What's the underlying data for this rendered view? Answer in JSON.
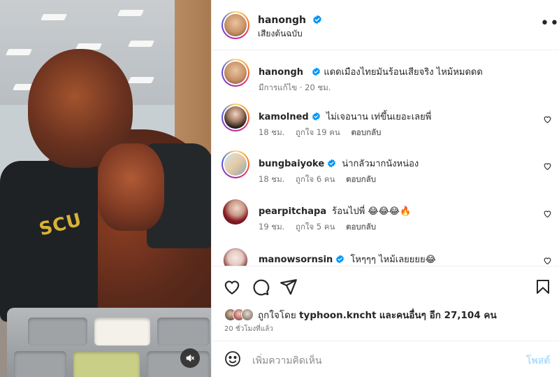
{
  "post": {
    "author": "hanongh",
    "audio": "เสียงต้นฉบับ",
    "caption": "แดดเมืองไทยมันร้อนเสียจริง ไหม้หมดดด",
    "caption_meta": "มีการแก้ไข · 20 ชม.",
    "media": {
      "patch_text": "SCU",
      "mute_icon": "speaker-muted-icon"
    }
  },
  "comments": [
    {
      "username": "kamolned",
      "verified": true,
      "text": "ไม่เจอนาน เท่ขึ้นเยอะเลยพี่",
      "time": "18 ชม.",
      "likes": "ถูกใจ 19 คน",
      "reply": "ตอบกลับ"
    },
    {
      "username": "bungbaiyoke",
      "verified": true,
      "text": "น่ากลัวมากนังหน่อง",
      "time": "18 ชม.",
      "likes": "ถูกใจ 6 คน",
      "reply": "ตอบกลับ"
    },
    {
      "username": "pearpitchapa",
      "verified": false,
      "text": "ร้อนไปพี่ 😂😂😂🔥",
      "time": "19 ชม.",
      "likes": "ถูกใจ 5 คน",
      "reply": "ตอบกลับ"
    },
    {
      "username": "manowsornsin",
      "verified": true,
      "text": "โหๆๆๆ ไหม้เลยยยย😂",
      "time": "",
      "likes": "",
      "reply": ""
    }
  ],
  "actions": {
    "like_icon": "heart-icon",
    "comment_icon": "comment-icon",
    "share_icon": "send-icon",
    "save_icon": "bookmark-icon",
    "liked_by_prefix": "ถูกใจโดย",
    "liked_by_user": "typhoon.kncht",
    "liked_by_suffix": "และคนอื่นๆ อีก 27,104 คน",
    "time_ago": "20 ชั่วโมงที่แล้ว"
  },
  "add_comment": {
    "emoji_icon": "emoji-icon",
    "placeholder": "เพิ่มความคิดเห็น",
    "post_label": "โพสต์"
  },
  "colors": {
    "verified": "#0095f6",
    "post_button_disabled": "#b2dffc",
    "meta_text": "#737373"
  }
}
